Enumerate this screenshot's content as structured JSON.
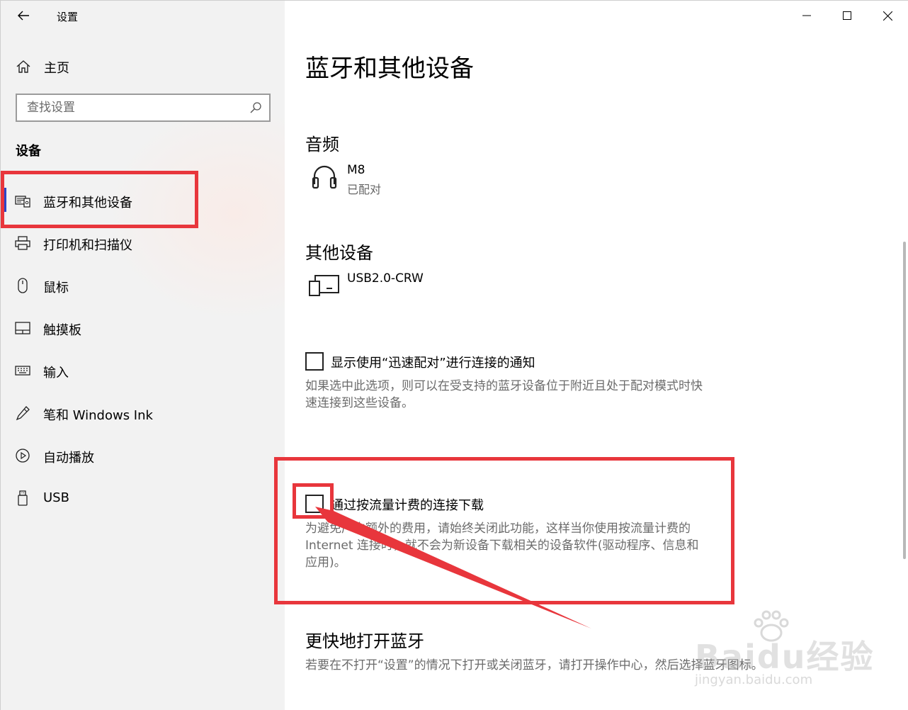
{
  "window": {
    "app_title": "设置",
    "controls": [
      "minimize",
      "maximize",
      "close"
    ]
  },
  "sidebar": {
    "home_label": "主页",
    "search": {
      "placeholder": "查找设置",
      "value": ""
    },
    "section_title": "设备",
    "items": [
      {
        "label": "蓝牙和其他设备",
        "icon": "bluetooth-devices-icon",
        "active": true
      },
      {
        "label": "打印机和扫描仪",
        "icon": "printer-icon",
        "active": false
      },
      {
        "label": "鼠标",
        "icon": "mouse-icon",
        "active": false
      },
      {
        "label": "触摸板",
        "icon": "touchpad-icon",
        "active": false
      },
      {
        "label": "输入",
        "icon": "keyboard-icon",
        "active": false
      },
      {
        "label": "笔和 Windows Ink",
        "icon": "pen-icon",
        "active": false
      },
      {
        "label": "自动播放",
        "icon": "autoplay-icon",
        "active": false
      },
      {
        "label": "USB",
        "icon": "usb-icon",
        "active": false
      }
    ]
  },
  "main": {
    "title": "蓝牙和其他设备",
    "audio": {
      "heading": "音频",
      "devices": [
        {
          "name": "M8",
          "status": "已配对",
          "icon": "headphones-icon"
        }
      ]
    },
    "other": {
      "heading": "其他设备",
      "devices": [
        {
          "name": "USB2.0-CRW",
          "icon": "device-icon"
        }
      ]
    },
    "swift_pair": {
      "label": "显示使用“迅速配对”进行连接的通知",
      "checked": false,
      "description": "如果选中此选项，则可以在受支持的蓝牙设备位于附近且处于配对模式时快速连接到这些设备。"
    },
    "metered": {
      "label": "通过按流量计费的连接下载",
      "checked": false,
      "description": "为避免产生额外的费用，请始终关闭此功能，这样当你使用按流量计费的Internet 连接时，就不会为新设备下载相关的设备软件(驱动程序、信息和应用)。"
    },
    "quick_bt": {
      "heading": "更快地打开蓝牙",
      "description": "若要在不打开“设置”的情况下打开或关闭蓝牙，请打开操作中心，然后选择蓝牙图标。"
    }
  },
  "watermark": {
    "brand": "Baidu经验",
    "url": "jingyan.baidu.com"
  },
  "colors": {
    "accent": "#2b46c7",
    "annotation": "#e8363c",
    "sidebar_bg": "#f2f2f2",
    "secondary_text": "#6b6b6b"
  }
}
